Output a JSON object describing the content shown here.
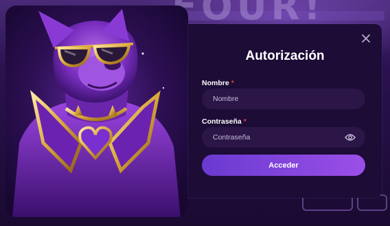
{
  "background": {
    "headline": "FOUR!"
  },
  "modal": {
    "title": "Autorización",
    "close_icon": "close-icon",
    "fields": [
      {
        "label": "Nombre",
        "required_mark": "*",
        "placeholder": "Nombre",
        "value": ""
      },
      {
        "label": "Contraseña",
        "required_mark": "*",
        "placeholder": "Contraseña",
        "value": "",
        "icon": "eye-icon"
      }
    ],
    "submit_label": "Acceder"
  },
  "colors": {
    "modal_bg": "#1c0c36",
    "field_bg": "#2b1647",
    "button_start": "#6a3ad0",
    "button_end": "#9a4fe8",
    "required": "#e0443e"
  }
}
